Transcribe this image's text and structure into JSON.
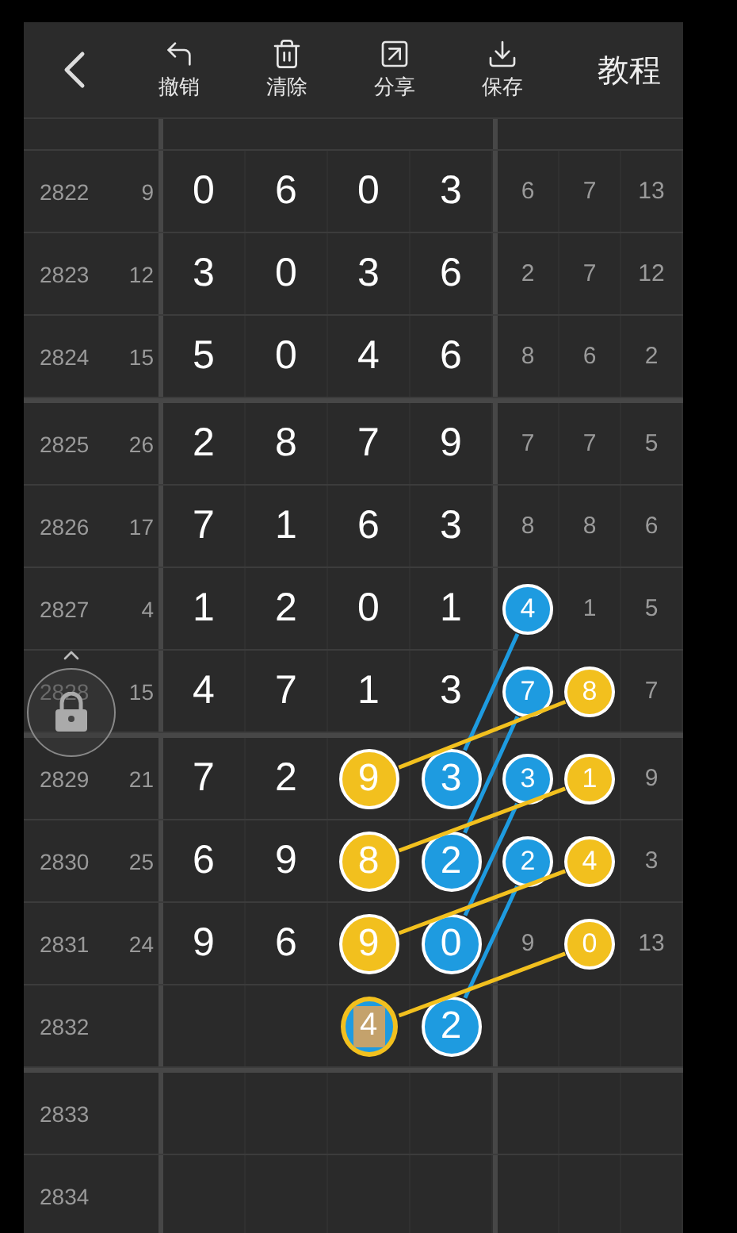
{
  "toolbar": {
    "back": {
      "kind": "back"
    },
    "actions": [
      {
        "label": "撤销",
        "kind": "undo"
      },
      {
        "label": "清除",
        "kind": "clear"
      },
      {
        "label": "分享",
        "kind": "share"
      },
      {
        "label": "保存",
        "kind": "save"
      }
    ],
    "tutorial": {
      "label": "教程"
    }
  },
  "groups": [
    [
      {
        "issue": "2822",
        "sum": "9",
        "digits": [
          {
            "value": "0"
          },
          {
            "value": "6"
          },
          {
            "value": "0"
          },
          {
            "value": "3"
          }
        ],
        "extras": [
          {
            "value": "6"
          },
          {
            "value": "7"
          },
          {
            "value": "13"
          }
        ]
      },
      {
        "issue": "2823",
        "sum": "12",
        "digits": [
          {
            "value": "3"
          },
          {
            "value": "0"
          },
          {
            "value": "3"
          },
          {
            "value": "6"
          }
        ],
        "extras": [
          {
            "value": "2"
          },
          {
            "value": "7"
          },
          {
            "value": "12"
          }
        ]
      },
      {
        "issue": "2824",
        "sum": "15",
        "digits": [
          {
            "value": "5"
          },
          {
            "value": "0"
          },
          {
            "value": "4"
          },
          {
            "value": "6"
          }
        ],
        "extras": [
          {
            "value": "8"
          },
          {
            "value": "6"
          },
          {
            "value": "2"
          }
        ]
      }
    ],
    [
      {
        "issue": "2825",
        "sum": "26",
        "digits": [
          {
            "value": "2"
          },
          {
            "value": "8"
          },
          {
            "value": "7"
          },
          {
            "value": "9"
          }
        ],
        "extras": [
          {
            "value": "7"
          },
          {
            "value": "7"
          },
          {
            "value": "5"
          }
        ]
      },
      {
        "issue": "2826",
        "sum": "17",
        "digits": [
          {
            "value": "7"
          },
          {
            "value": "1"
          },
          {
            "value": "6"
          },
          {
            "value": "3"
          }
        ],
        "extras": [
          {
            "value": "8"
          },
          {
            "value": "8"
          },
          {
            "value": "6"
          }
        ]
      },
      {
        "issue": "2827",
        "sum": "4",
        "digits": [
          {
            "value": "1"
          },
          {
            "value": "2"
          },
          {
            "value": "0"
          },
          {
            "value": "1"
          }
        ],
        "extras": [
          {
            "value": "4",
            "kind": "ball",
            "color": "#1e9be0"
          },
          {
            "value": "1"
          },
          {
            "value": "5"
          }
        ]
      },
      {
        "issue": "2828",
        "sum": "15",
        "digits": [
          {
            "value": "4"
          },
          {
            "value": "7"
          },
          {
            "value": "1"
          },
          {
            "value": "3"
          }
        ],
        "extras": [
          {
            "value": "7",
            "kind": "ball",
            "color": "#1e9be0"
          },
          {
            "value": "8",
            "kind": "ball",
            "color": "#f2c01e"
          },
          {
            "value": "7"
          }
        ]
      }
    ],
    [
      {
        "issue": "2829",
        "sum": "21",
        "digits": [
          {
            "value": "7"
          },
          {
            "value": "2"
          },
          {
            "value": "9",
            "kind": "ball",
            "color": "#f2c01e"
          },
          {
            "value": "3",
            "kind": "ball",
            "color": "#1e9be0"
          }
        ],
        "extras": [
          {
            "value": "3",
            "kind": "ball",
            "color": "#1e9be0"
          },
          {
            "value": "1",
            "kind": "ball",
            "color": "#f2c01e"
          },
          {
            "value": "9"
          }
        ]
      },
      {
        "issue": "2830",
        "sum": "25",
        "digits": [
          {
            "value": "6"
          },
          {
            "value": "9"
          },
          {
            "value": "8",
            "kind": "ball",
            "color": "#f2c01e"
          },
          {
            "value": "2",
            "kind": "ball",
            "color": "#1e9be0"
          }
        ],
        "extras": [
          {
            "value": "2",
            "kind": "ball",
            "color": "#1e9be0"
          },
          {
            "value": "4",
            "kind": "ball",
            "color": "#f2c01e"
          },
          {
            "value": "3"
          }
        ]
      },
      {
        "issue": "2831",
        "sum": "24",
        "digits": [
          {
            "value": "9"
          },
          {
            "value": "6"
          },
          {
            "value": "9",
            "kind": "ball",
            "color": "#f2c01e"
          },
          {
            "value": "0",
            "kind": "ball",
            "color": "#1e9be0"
          }
        ],
        "extras": [
          {
            "value": "9"
          },
          {
            "value": "0",
            "kind": "ball",
            "color": "#f2c01e"
          },
          {
            "value": "13"
          }
        ]
      },
      {
        "issue": "2832",
        "digits": [
          {
            "kind": "blank"
          },
          {
            "kind": "blank"
          },
          {
            "value": "4",
            "kind": "tile",
            "color": "#f2c01e"
          },
          {
            "value": "2",
            "kind": "ball",
            "color": "#1e9be0"
          }
        ],
        "extras": [
          {
            "kind": "blank"
          },
          {
            "kind": "blank"
          },
          {
            "kind": "blank"
          }
        ]
      }
    ],
    [
      {
        "issue": "2833",
        "digits": [
          {
            "kind": "blank"
          },
          {
            "kind": "blank"
          },
          {
            "kind": "blank"
          },
          {
            "kind": "blank"
          }
        ],
        "extras": [
          {
            "kind": "blank"
          },
          {
            "kind": "blank"
          },
          {
            "kind": "blank"
          }
        ]
      },
      {
        "issue": "2834",
        "digits": [
          {
            "kind": "blank"
          },
          {
            "kind": "blank"
          },
          {
            "kind": "blank"
          },
          {
            "kind": "blank"
          }
        ],
        "extras": [
          {
            "kind": "blank"
          },
          {
            "kind": "blank"
          },
          {
            "kind": "blank"
          }
        ]
      }
    ]
  ],
  "lock": {
    "locked": true
  }
}
